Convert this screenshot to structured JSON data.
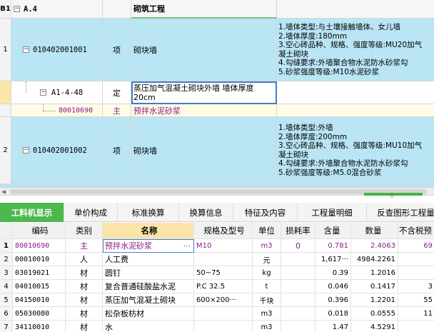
{
  "upper": {
    "section": {
      "num": "B1",
      "toggle": "−",
      "code": "A.4",
      "name": "砌筑工程"
    },
    "items": [
      {
        "num": "1",
        "toggle": "−",
        "code": "010402001001",
        "type": "项",
        "name": "砌块墙",
        "features": "1.墙体类型:与土壤接触墙体、女儿墙\n2.墙体厚度:180mm\n3.空心砖品种、规格、强度等级:MU20加气\n凝土砌块\n4.勾缝要求:外墙聚合物水泥防水砂浆勾\n5.砂浆强度等级:M10水泥砂浆"
      },
      {
        "num": "2",
        "toggle": "−",
        "code": "010402001002",
        "type": "项",
        "name": "砌块墙",
        "features": "1.墙体类型:外墙\n2.墙体厚度:200mm\n3.空心砖品种、规格、强度等级:MU10加气\n凝土砌块\n4.勾缝要求:外墙聚合物水泥防水砂浆勾\n5.砂浆强度等级:M5.0混合砂浆"
      }
    ],
    "quota": {
      "toggle": "−",
      "code": "A1-4-48",
      "type": "定",
      "name_line1": "蒸压加气混凝土砌块外墙 墙体厚度",
      "name_line2": "20cm"
    },
    "material": {
      "code": "80010690",
      "type": "主",
      "name": "预拌水泥砂浆"
    }
  },
  "tabs": [
    "工料机显示",
    "单价构成",
    "标准换算",
    "换算信息",
    "特征及内容",
    "工程量明细",
    "反查图形工程量"
  ],
  "lower": {
    "headers": [
      "",
      "编码",
      "类别",
      "名称",
      "规格及型号",
      "单位",
      "损耗率",
      "含量",
      "数量",
      "不含税预"
    ],
    "rows": [
      {
        "n": "1",
        "code": "80010690",
        "cat": "主",
        "name": "预拌水泥砂浆",
        "name_more": "···",
        "spec": "M10",
        "unit": "m3",
        "loss": "0",
        "content": "0.781",
        "qty": "2.4063",
        "price": "69"
      },
      {
        "n": "2",
        "code": "00010010",
        "cat": "人",
        "name": "人工费",
        "spec": "",
        "unit": "元",
        "loss": "",
        "content": "1,617···",
        "qty": "4984.2261",
        "price": ""
      },
      {
        "n": "3",
        "code": "03019021",
        "cat": "材",
        "name": "圆钉",
        "spec": "50~75",
        "unit": "kg",
        "loss": "",
        "content": "0.39",
        "qty": "1.2016",
        "price": ""
      },
      {
        "n": "4",
        "code": "04010015",
        "cat": "材",
        "name": "复合普通硅酸盐水泥",
        "spec": "P.C 32.5",
        "unit": "t",
        "loss": "",
        "content": "0.046",
        "qty": "0.1417",
        "price": "3"
      },
      {
        "n": "5",
        "code": "04150010",
        "cat": "材",
        "name": "蒸压加气混凝土砌块",
        "spec": "600×200···",
        "unit": "千块",
        "loss": "",
        "content": "0.396",
        "qty": "1.2201",
        "price": "55"
      },
      {
        "n": "6",
        "code": "05030080",
        "cat": "材",
        "name": "松杂板枋材",
        "spec": "",
        "unit": "m3",
        "loss": "",
        "content": "0.018",
        "qty": "0.0555",
        "price": "11"
      },
      {
        "n": "7",
        "code": "34110010",
        "cat": "材",
        "name": "水",
        "spec": "",
        "unit": "m3",
        "loss": "",
        "content": "1.47",
        "qty": "4.5291",
        "price": ""
      }
    ]
  },
  "colors": {
    "blue_row": "#b9e5f5",
    "pale_row": "#fffbe4",
    "tab_active": "#4cb84e",
    "purple": "#8b1a8b"
  },
  "icons": [
    "collapse-box-icon",
    "scroll-left-arrow-icon",
    "grip-handle-icon"
  ]
}
